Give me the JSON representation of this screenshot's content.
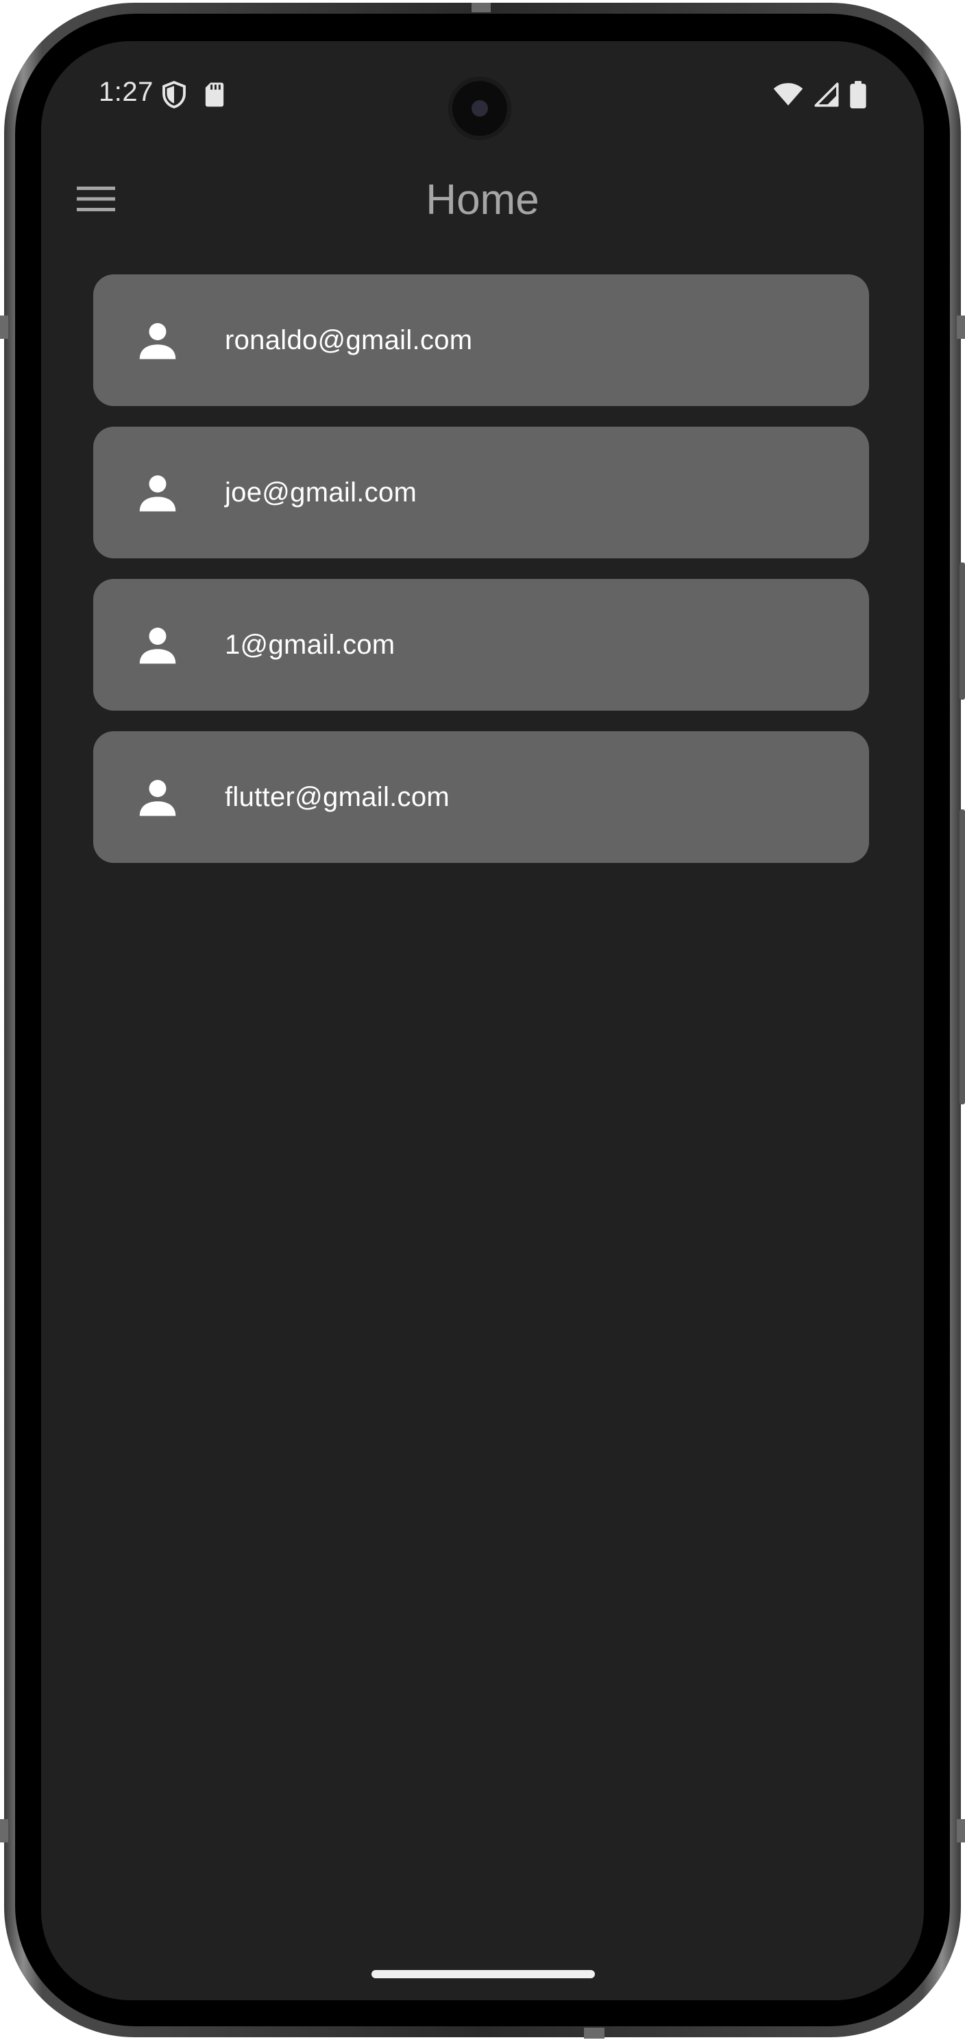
{
  "status_bar": {
    "time": "1:27",
    "left_icons": [
      "shield-icon",
      "sd-card-icon"
    ],
    "right_icons": [
      "wifi-icon",
      "cellular-signal-icon",
      "battery-icon"
    ]
  },
  "app_bar": {
    "menu_icon": "hamburger-menu-icon",
    "title": "Home"
  },
  "users": [
    {
      "icon": "person-icon",
      "email": "ronaldo@gmail.com"
    },
    {
      "icon": "person-icon",
      "email": "joe@gmail.com"
    },
    {
      "icon": "person-icon",
      "email": "1@gmail.com"
    },
    {
      "icon": "person-icon",
      "email": "flutter@gmail.com"
    }
  ],
  "colors": {
    "screen_background": "#212121",
    "card_background": "#646464",
    "title_text": "#a6a6a6",
    "card_text": "#ffffff"
  }
}
